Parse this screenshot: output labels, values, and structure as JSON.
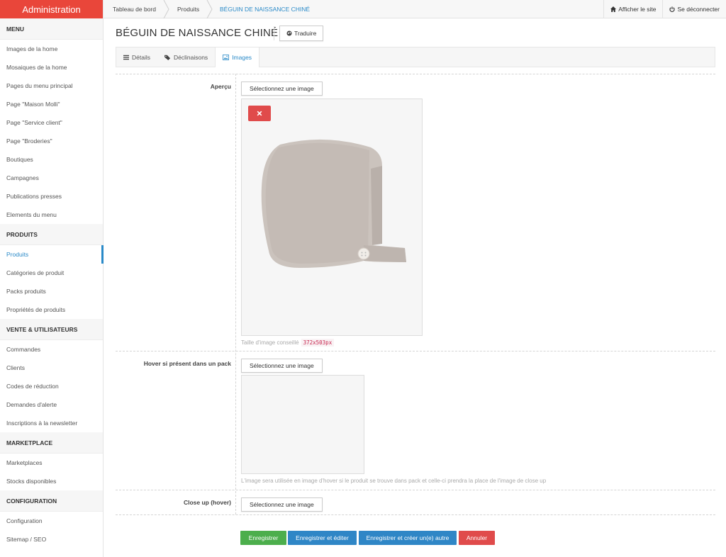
{
  "app": {
    "brand": "Administration"
  },
  "sidebar": {
    "sections": [
      {
        "header": "MENU",
        "items": [
          "Images de la home",
          "Mosaiques de la home",
          "Pages du menu principal",
          "Page \"Maison Molli\"",
          "Page \"Service client\"",
          "Page \"Broderies\"",
          "Boutiques",
          "Campagnes",
          "Publications presses",
          "Elements du menu"
        ]
      },
      {
        "header": "PRODUITS",
        "items": [
          "Produits",
          "Catégories de produit",
          "Packs produits",
          "Propriétés de produits"
        ]
      },
      {
        "header": "VENTE & UTILISATEURS",
        "items": [
          "Commandes",
          "Clients",
          "Codes de réduction",
          "Demandes d'alerte",
          "Inscriptions à la newsletter"
        ]
      },
      {
        "header": "MARKETPLACE",
        "items": [
          "Marketplaces",
          "Stocks disponibles"
        ]
      },
      {
        "header": "CONFIGURATION",
        "items": [
          "Configuration",
          "Sitemap / SEO"
        ]
      }
    ],
    "active_item": "Produits"
  },
  "breadcrumb": [
    "Tableau de bord",
    "Produits",
    "BÉGUIN DE NAISSANCE CHINÉ"
  ],
  "topbar": {
    "view_site": "Afficher le site",
    "logout": "Se déconnecter"
  },
  "page": {
    "title": "BÉGUIN DE NAISSANCE CHINÉ",
    "translate_label": "Traduire"
  },
  "tabs": [
    {
      "label": "Détails",
      "icon": "list-icon"
    },
    {
      "label": "Déclinaisons",
      "icon": "tags-icon"
    },
    {
      "label": "Images",
      "icon": "image-icon",
      "active": true
    }
  ],
  "fields": {
    "apercu": {
      "label": "Aperçu",
      "select_label": "Sélectionnez une image",
      "help_text": "Taille d'image conseillé",
      "size": "372x503px"
    },
    "hover": {
      "label": "Hover si présent dans un pack",
      "select_label": "Sélectionnez une image",
      "help_text": "L'image sera utilisée en image d'hover si le produit se trouve dans pack et celle-ci prendra la place de l'image de close up"
    },
    "closeup": {
      "label": "Close up (hover)",
      "select_label": "Sélectionnez une image"
    }
  },
  "actions": {
    "save": "Enregistrer",
    "save_edit": "Enregistrer et éditer",
    "save_new": "Enregistrer et créer un(e) autre",
    "cancel": "Annuler"
  },
  "colors": {
    "brand": "#e9463a",
    "accent": "#2a8ac8",
    "success": "#4cae4c",
    "danger": "#e04b4b"
  }
}
